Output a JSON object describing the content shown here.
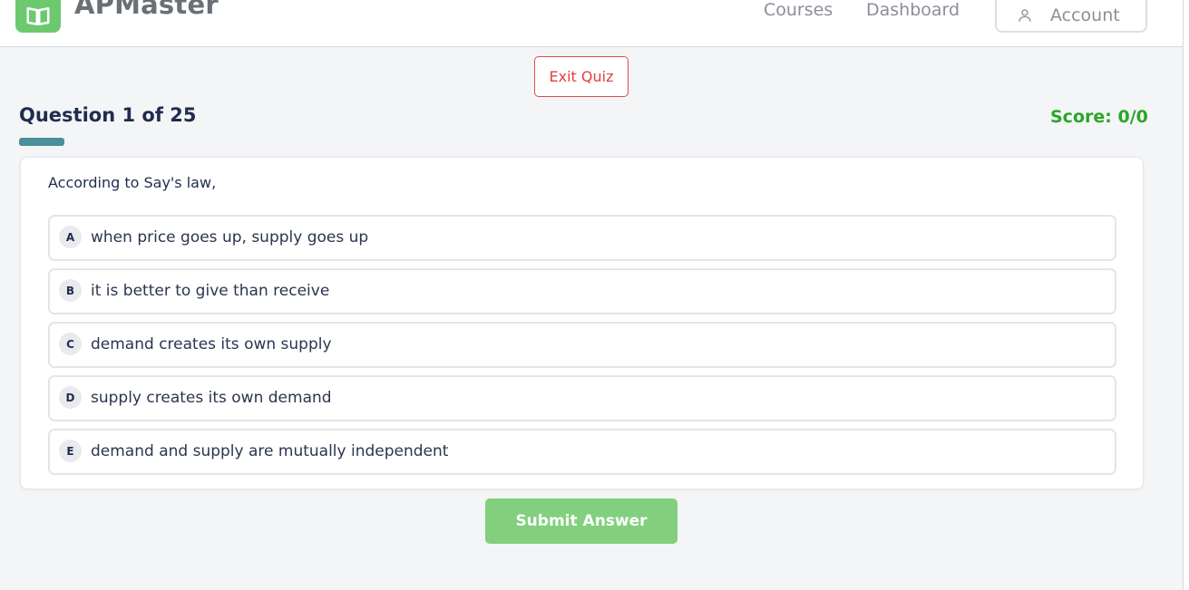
{
  "header": {
    "brand": "APMaster",
    "nav": {
      "courses": "Courses",
      "dashboard": "Dashboard"
    },
    "account_label": "Account"
  },
  "quiz": {
    "exit_label": "Exit Quiz",
    "question_progress": "Question 1 of 25",
    "score": "Score: 0/0",
    "progress_fraction": 0.04,
    "question": "According to Say's law,",
    "options": [
      {
        "letter": "A",
        "text": "when price goes up, supply goes up"
      },
      {
        "letter": "B",
        "text": "it is better to give than receive"
      },
      {
        "letter": "C",
        "text": "demand creates its own supply"
      },
      {
        "letter": "D",
        "text": "supply creates its own demand"
      },
      {
        "letter": "E",
        "text": "demand and supply are mutually independent"
      }
    ],
    "submit_label": "Submit Answer"
  },
  "colors": {
    "brand_green": "#6cc96e",
    "score_green": "#2aa52a",
    "exit_red": "#e04040",
    "progress": "#4a8f99",
    "submit_green": "#82d07d"
  },
  "icons": {
    "logo": "open-book-icon",
    "account": "user-icon"
  }
}
